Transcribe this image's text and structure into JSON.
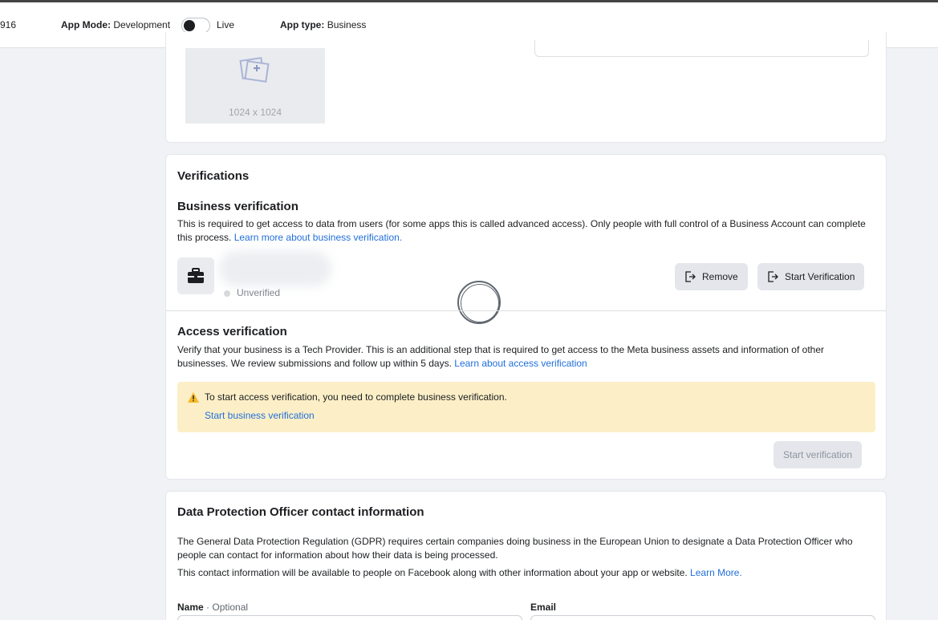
{
  "topbar": {
    "app_id_suffix": "916",
    "app_mode_label": "App Mode:",
    "app_mode_value": "Development",
    "live_label": "Live",
    "app_type_label": "App type:",
    "app_type_value": "Business",
    "mode_toggle_state": "off"
  },
  "app_icon": {
    "size_text": "1024 x 1024",
    "icon": "image-add-icon"
  },
  "verifications": {
    "title": "Verifications",
    "business": {
      "title": "Business verification",
      "description": "This is required to get access to data from users (for some apps this is called advanced access). Only people with full control of a Business Account can complete this process.",
      "link": "Learn more about business verification.",
      "status": "Unverified",
      "remove_button": "Remove",
      "start_button": "Start Verification",
      "icon": "briefcase-icon"
    },
    "access": {
      "title": "Access verification",
      "description": "Verify that your business is a Tech Provider. This is an additional step that is required to get access to the Meta business assets and information of other businesses. We review submissions and follow up within 5 days.",
      "link": "Learn about access verification",
      "warning_text": "To start access verification, you need to complete business verification.",
      "warning_link": "Start business verification",
      "start_button": "Start verification"
    }
  },
  "dpo": {
    "title": "Data Protection Officer contact information",
    "description": "The General Data Protection Regulation (GDPR) requires certain companies doing business in the European Union to designate a Data Protection Officer who people can contact for information about how their data is being processed.",
    "description2": "This contact information will be available to people on Facebook along with other information about your app or website.",
    "learn_more": "Learn More.",
    "name_label": "Name",
    "name_optional": "· Optional",
    "email_label": "Email"
  },
  "colors": {
    "link": "#216fdb",
    "warning_bg": "#fcefc7",
    "warning_icon": "#f7b928",
    "page_bg": "#f0f2f5"
  }
}
